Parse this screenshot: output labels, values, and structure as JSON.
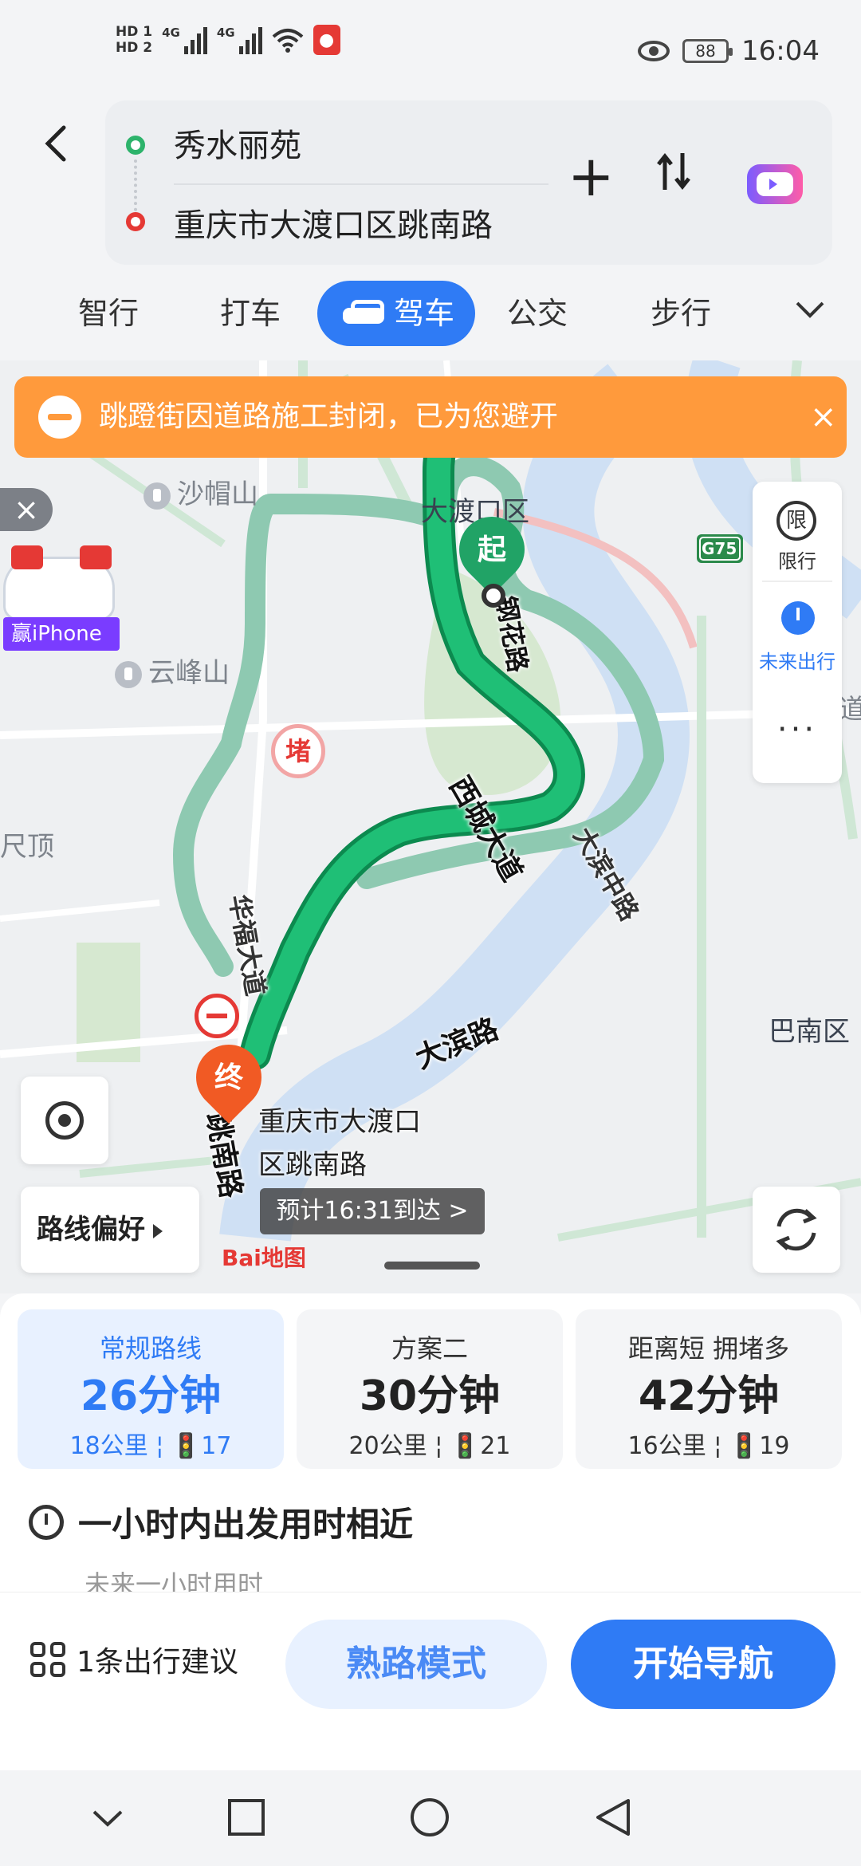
{
  "status_bar": {
    "hd1": "HD 1",
    "hd2": "HD 2",
    "sig1": "4G",
    "sig2": "4G",
    "battery": "88",
    "time": "16:04"
  },
  "route": {
    "from": "秀水丽苑",
    "to": "重庆市大渡口区跳南路"
  },
  "tabs": [
    {
      "label": "智行"
    },
    {
      "label": "打车"
    },
    {
      "label": "驾车",
      "active": true
    },
    {
      "label": "公交"
    },
    {
      "label": "步行"
    }
  ],
  "banner": {
    "text": "跳蹬街因道路施工封闭，已为您避开",
    "close": "×"
  },
  "ad": {
    "close": "×",
    "text": "赢iPhone"
  },
  "side_panel": {
    "restrict_icon": "限",
    "restrict_label": "限行",
    "future_label": "未来出行",
    "more": "···"
  },
  "map": {
    "labels": {
      "shamaoshan": "沙帽山",
      "dadukou": "大渡口区",
      "yunfengshan": "云峰山",
      "chiding": "尺顶",
      "banan": "巴南区",
      "jiao": "道",
      "g75": "G75"
    },
    "roads": {
      "jinghua": "钢花路",
      "xiyuan": "西城大道",
      "dabin": "大滨路",
      "dabinzhong": "大滨中路",
      "huafu": "华福大道",
      "tiaonan": "跳南路"
    },
    "badges": {
      "congestion": "堵"
    },
    "pins": {
      "start": "起",
      "end": "终"
    },
    "destination_label": "重庆市大渡口区跳南路",
    "eta": "预计16:31到达 >",
    "logo": "Bai地图",
    "route_pref": "路线偏好"
  },
  "route_options": [
    {
      "title": "常规路线",
      "time": "26分钟",
      "meta": "18公里 ¦ 🚦17",
      "active": true
    },
    {
      "title": "方案二",
      "time": "30分钟",
      "meta": "20公里 ¦ 🚦21",
      "active": false
    },
    {
      "title": "距离短  拥堵多",
      "time": "42分钟",
      "meta": "16公里 ¦ 🚦19",
      "active": false
    }
  ],
  "depart": {
    "title": "一小时内出发用时相近",
    "subtitle": "未来一小时用时"
  },
  "actions": {
    "tips": "1条出行建议",
    "familiar": "熟路模式",
    "start_nav": "开始导航"
  },
  "colors": {
    "accent": "#2f7bf5",
    "route_green": "#1aa864",
    "banner_orange": "#ff9a3c"
  }
}
